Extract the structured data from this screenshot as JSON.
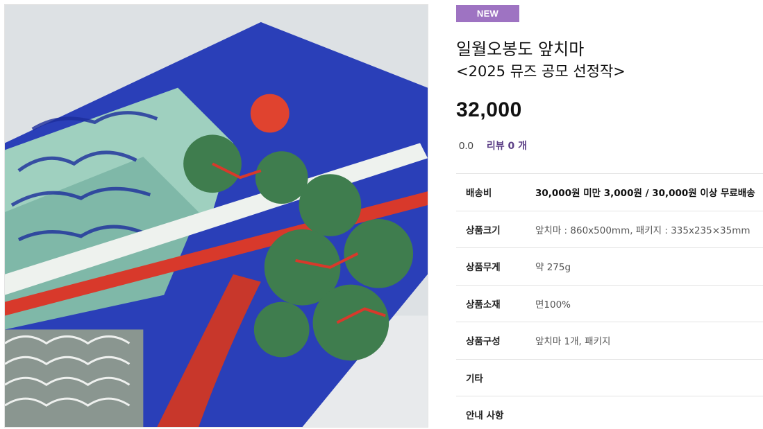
{
  "product": {
    "badge": "NEW",
    "title": "일월오봉도 앞치마",
    "subtitle": "<2025 뮤즈 공모 선정작>",
    "price": "32,000",
    "rating": "0.0",
    "review_label": "리뷰 0 개",
    "image_alt": "일월오봉도 앞치마 상품 사진"
  },
  "specs": [
    {
      "label": "배송비",
      "value": "30,000원 미만 3,000원 / 30,000원 이상 무료배송"
    },
    {
      "label": "상품크기",
      "value": "앞치마 : 860x500mm, 패키지 : 335x235×35mm"
    },
    {
      "label": "상품무게",
      "value": "약 275g"
    },
    {
      "label": "상품소재",
      "value": "면100%"
    },
    {
      "label": "상품구성",
      "value": "앞치마 1개, 패키지"
    },
    {
      "label": "기타",
      "value": ""
    },
    {
      "label": "안내 사항",
      "value": ""
    }
  ],
  "colors": {
    "badge": "#9e73c2",
    "review_link": "#5b3e86",
    "divider": "#e3e3e3"
  }
}
